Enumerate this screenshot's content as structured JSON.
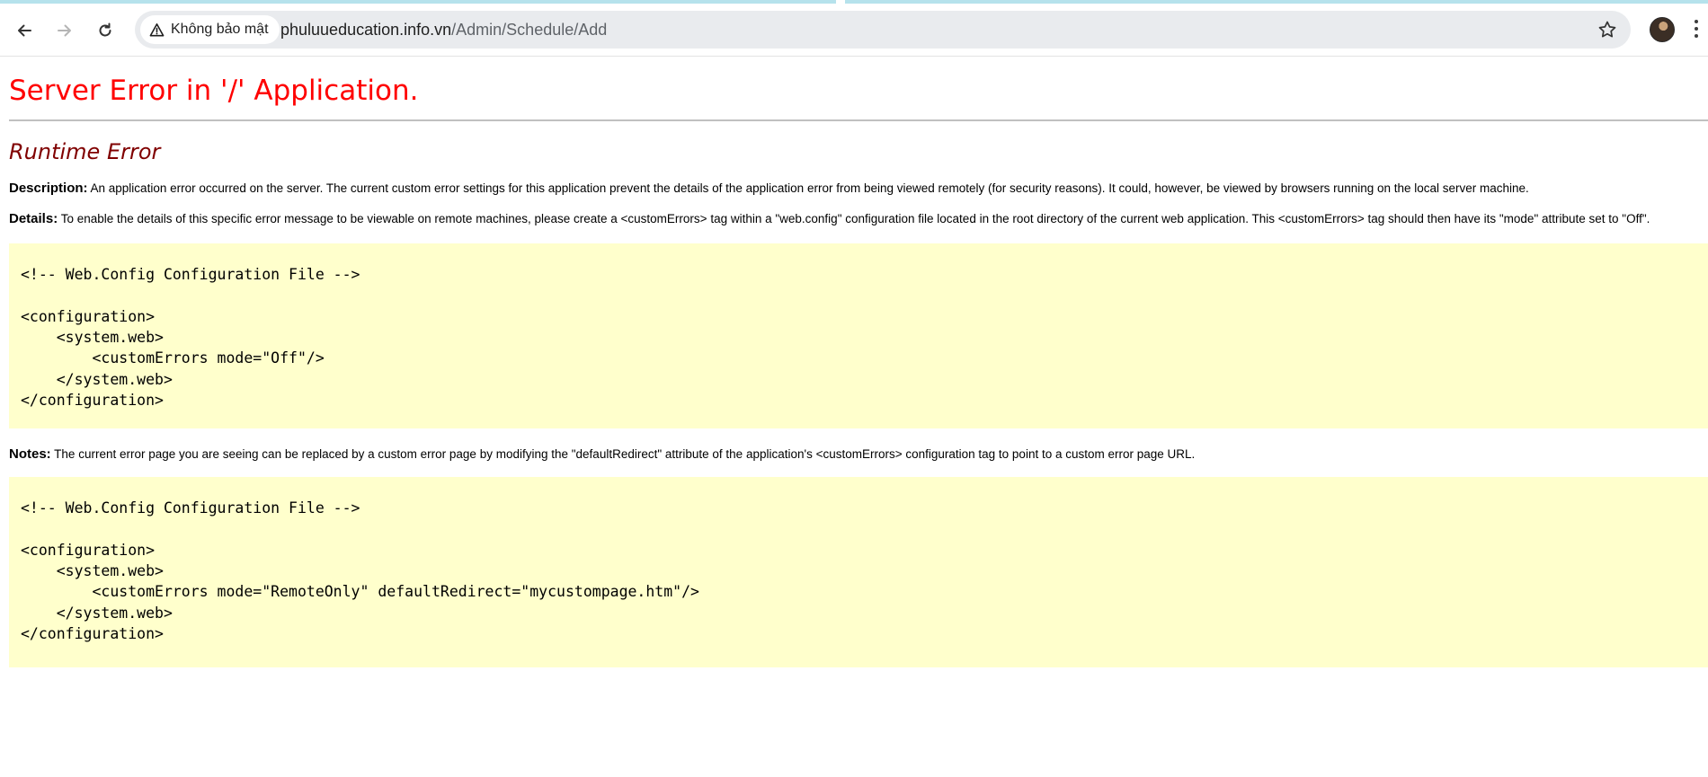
{
  "browser": {
    "security_label": "Không bảo mật",
    "url_host": "phuluueducation.info.vn",
    "url_path": "/Admin/Schedule/Add"
  },
  "page": {
    "title": "Server Error in '/' Application.",
    "subtitle": "Runtime Error",
    "description_label": "Description:",
    "description_text": " An application error occurred on the server. The current custom error settings for this application prevent the details of the application error from being viewed remotely (for security reasons). It could, however, be viewed by browsers running on the local server machine.",
    "details_label": "Details:",
    "details_text": " To enable the details of this specific error message to be viewable on remote machines, please create a <customErrors> tag within a \"web.config\" configuration file located in the root directory of the current web application. This <customErrors> tag should then have its \"mode\" attribute set to \"Off\".",
    "code1": "\n<!-- Web.Config Configuration File -->\n\n<configuration>\n    <system.web>\n        <customErrors mode=\"Off\"/>\n    </system.web>\n</configuration>",
    "notes_label": "Notes:",
    "notes_text": " The current error page you are seeing can be replaced by a custom error page by modifying the \"defaultRedirect\" attribute of the application's <customErrors> configuration tag to point to a custom error page URL.",
    "code2": "\n<!-- Web.Config Configuration File -->\n\n<configuration>\n    <system.web>\n        <customErrors mode=\"RemoteOnly\" defaultRedirect=\"mycustompage.htm\"/>\n    </system.web>\n</configuration>"
  },
  "colors": {
    "title": "#ff0000",
    "subtitle": "#800000",
    "code_background": "#ffffcc"
  }
}
